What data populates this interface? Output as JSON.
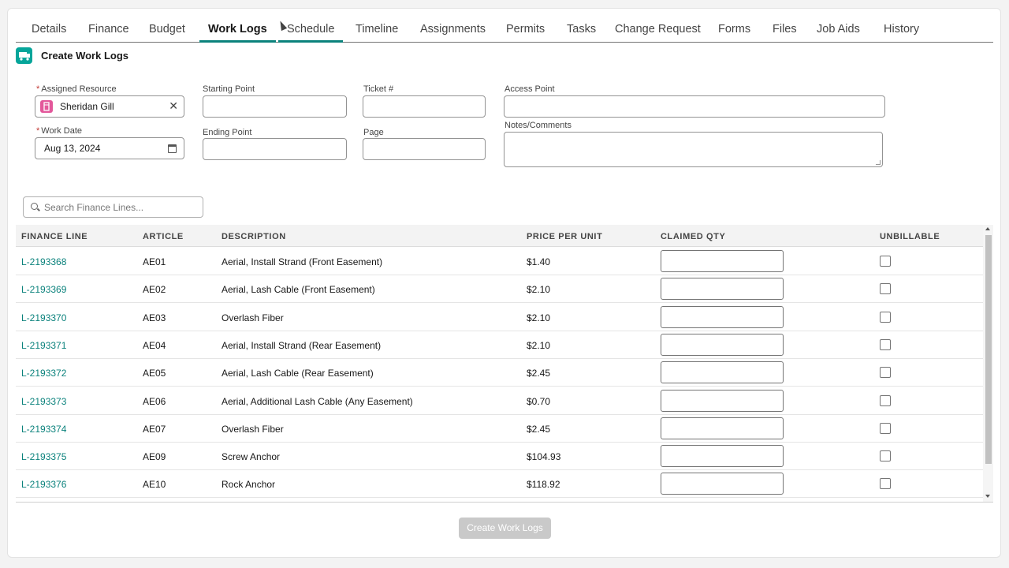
{
  "tabs": [
    "Details",
    "Finance",
    "Budget",
    "Work Logs",
    "Schedule",
    "Timeline",
    "Assignments",
    "Permits",
    "Tasks",
    "Change Request",
    "Forms",
    "Files",
    "Job Aids",
    "History"
  ],
  "active_tab": "Work Logs",
  "header": {
    "title": "Create Work Logs",
    "icon": "truck-icon"
  },
  "form": {
    "assigned_resource": {
      "label": "Assigned Resource",
      "required_mark": "*",
      "value": "Sheridan Gill",
      "icon": "resource-icon",
      "clear_icon": "✕"
    },
    "work_date": {
      "label": "Work Date",
      "required_mark": "*",
      "value": "Aug 13, 2024",
      "icon": "calendar-icon"
    },
    "starting_point": {
      "label": "Starting Point",
      "value": ""
    },
    "ending_point": {
      "label": "Ending Point",
      "value": ""
    },
    "ticket": {
      "label": "Ticket #",
      "value": ""
    },
    "page": {
      "label": "Page",
      "value": ""
    },
    "access_point": {
      "label": "Access Point",
      "value": ""
    },
    "notes": {
      "label": "Notes/Comments",
      "value": ""
    }
  },
  "search": {
    "placeholder": "Search Finance Lines..."
  },
  "table": {
    "columns": [
      "FINANCE LINE",
      "ARTICLE",
      "DESCRIPTION",
      "PRICE PER UNIT",
      "CLAIMED QTY",
      "UNBILLABLE"
    ],
    "rows": [
      {
        "finance_line": "L-2193368",
        "article": "AE01",
        "description": "Aerial, Install Strand (Front Easement)",
        "price": "$1.40"
      },
      {
        "finance_line": "L-2193369",
        "article": "AE02",
        "description": "Aerial, Lash Cable (Front Easement)",
        "price": "$2.10"
      },
      {
        "finance_line": "L-2193370",
        "article": "AE03",
        "description": "Overlash Fiber",
        "price": "$2.10"
      },
      {
        "finance_line": "L-2193371",
        "article": "AE04",
        "description": "Aerial, Install Strand (Rear Easement)",
        "price": "$2.10"
      },
      {
        "finance_line": "L-2193372",
        "article": "AE05",
        "description": "Aerial, Lash Cable (Rear Easement)",
        "price": "$2.45"
      },
      {
        "finance_line": "L-2193373",
        "article": "AE06",
        "description": "Aerial, Additional Lash Cable (Any Easement)",
        "price": "$0.70"
      },
      {
        "finance_line": "L-2193374",
        "article": "AE07",
        "description": "Overlash Fiber",
        "price": "$2.45"
      },
      {
        "finance_line": "L-2193375",
        "article": "AE09",
        "description": "Screw Anchor",
        "price": "$104.93"
      },
      {
        "finance_line": "L-2193376",
        "article": "AE10",
        "description": "Rock Anchor",
        "price": "$118.92"
      }
    ]
  },
  "submit_label": "Create Work Logs",
  "colors": {
    "accent": "#0b827c",
    "header_icon": "#06a59a",
    "resource_icon": "#e3589b",
    "required": "#c23934",
    "button_disabled": "#c9c9c9"
  }
}
